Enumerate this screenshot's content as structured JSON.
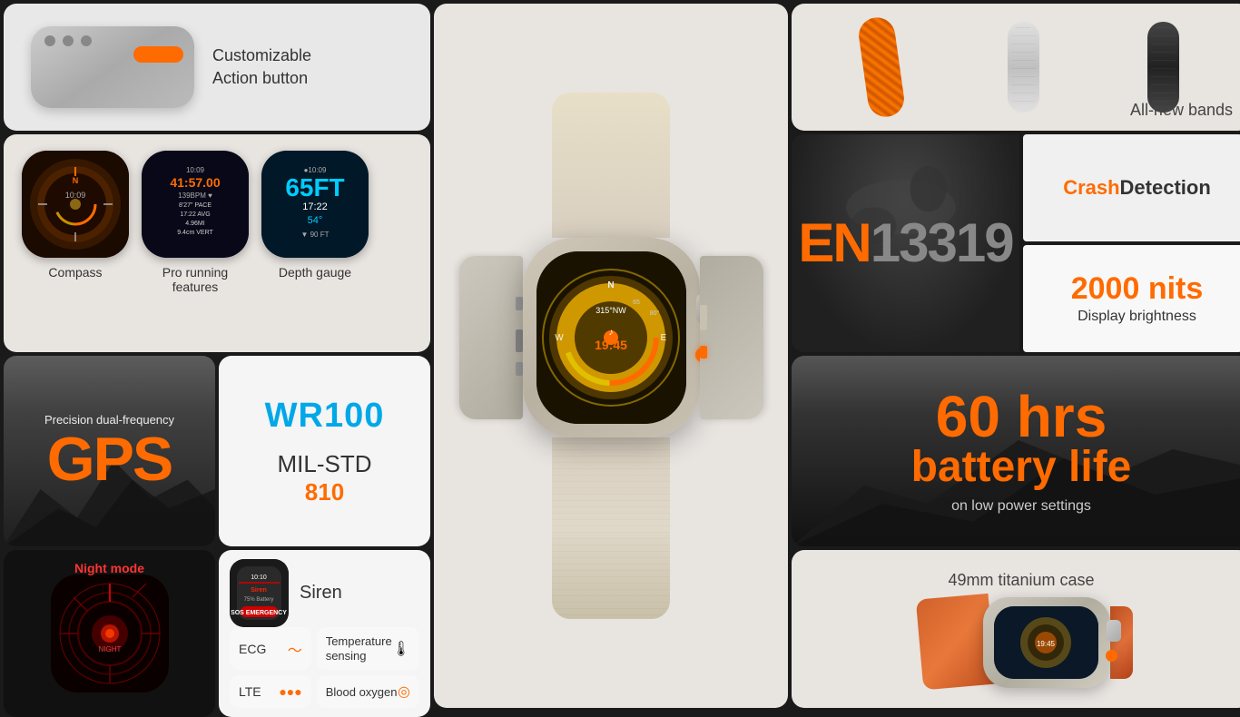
{
  "actionButton": {
    "label": "Customizable\nAction button"
  },
  "bands": {
    "label": "All-new bands"
  },
  "watchFaces": {
    "items": [
      {
        "label": "Compass"
      },
      {
        "label": "Pro running\nfeatures"
      },
      {
        "label": "Depth gauge"
      }
    ]
  },
  "diveSpec": {
    "standard": "EN13319",
    "en_text": "EN",
    "num_text": "13319"
  },
  "crashDetection": {
    "label_part1": "Crash",
    "label_part2": "Detection"
  },
  "displayBrightness": {
    "value": "2000 nits",
    "label": "Display brightness"
  },
  "gps": {
    "subtitle": "Precision dual-frequency",
    "main": "GPS"
  },
  "waterResistance": {
    "wr": "WR100",
    "milstd_label": "MIL-STD",
    "milstd_num": "810"
  },
  "battery": {
    "hours": "60 hrs",
    "label": "battery life",
    "sublabel": "on low power settings"
  },
  "nightMode": {
    "label": "Night mode"
  },
  "siren": {
    "label": "Siren"
  },
  "features": [
    {
      "name": "ECG",
      "icon": "♡~"
    },
    {
      "name": "Temperature\nsensing",
      "icon": "🌡"
    },
    {
      "name": "LTE",
      "icon": "•••"
    },
    {
      "name": "Blood oxygen",
      "icon": "◎"
    }
  ],
  "titanium": {
    "label": "49mm titanium case"
  },
  "colors": {
    "orange": "#ff6b00",
    "blue": "#00a8e8",
    "dark_bg": "#2a2a2a"
  }
}
